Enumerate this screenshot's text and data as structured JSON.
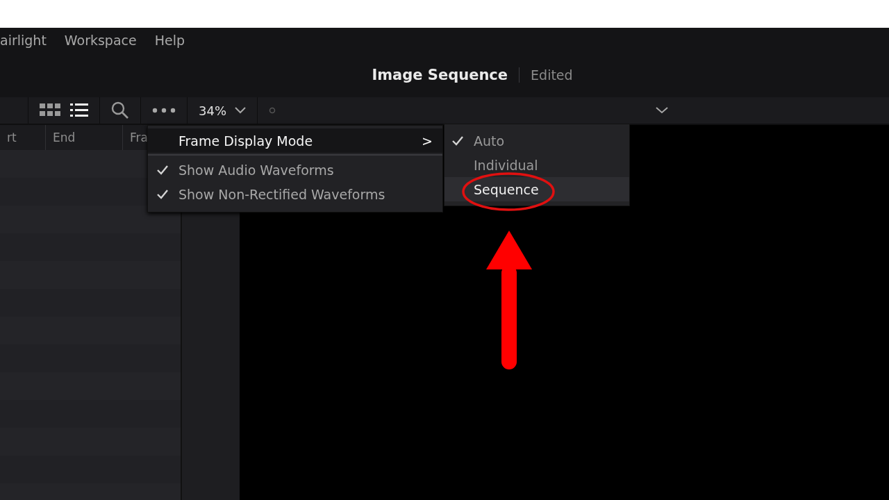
{
  "menu_bar": {
    "items": [
      "airlight",
      "Workspace",
      "Help"
    ]
  },
  "title_bar": {
    "title": "Image Sequence",
    "status": "Edited"
  },
  "toolbar": {
    "view_modes": [
      {
        "kind": "grid",
        "selected": false
      },
      {
        "kind": "list",
        "selected": true
      }
    ],
    "zoom": "34%"
  },
  "media_pool": {
    "columns": [
      "rt",
      "End",
      "Fra"
    ]
  },
  "context_menu": {
    "items": [
      {
        "kind": "submenu",
        "label": "Frame Display Mode",
        "expanded": true,
        "arrow": ">"
      },
      {
        "kind": "check",
        "label": "Show Audio Waveforms",
        "checked": true
      },
      {
        "kind": "check",
        "label": "Show Non-Rectified Waveforms",
        "checked": true
      }
    ]
  },
  "submenu": {
    "items": [
      {
        "label": "Auto",
        "checked": true,
        "selected": false
      },
      {
        "label": "Individual",
        "checked": false,
        "selected": false
      },
      {
        "label": "Sequence",
        "checked": false,
        "selected": true
      }
    ]
  }
}
